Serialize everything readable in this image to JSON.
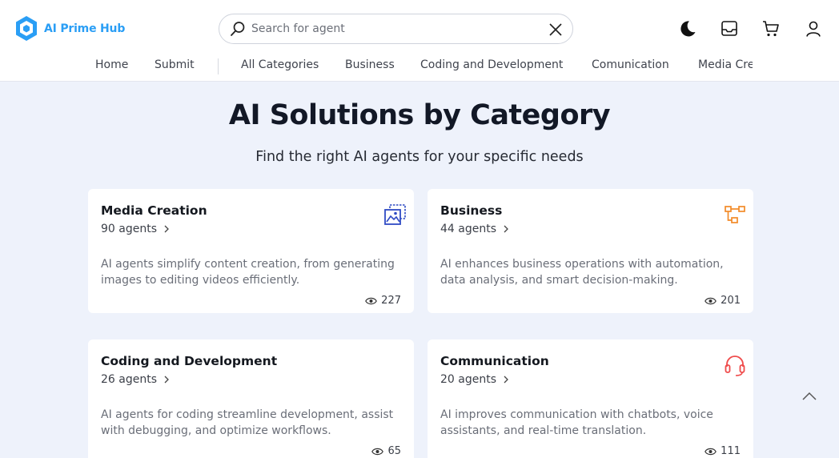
{
  "brand": {
    "name": "AI Prime Hub",
    "color": "#2a9ef5"
  },
  "search": {
    "placeholder": "Search for agent",
    "value": ""
  },
  "header_icons": [
    "moon-icon",
    "inbox-icon",
    "cart-icon",
    "user-icon"
  ],
  "nav": {
    "items": [
      {
        "label": "Home"
      },
      {
        "label": "Submit"
      },
      {
        "label": "All Categories"
      },
      {
        "label": "Business"
      },
      {
        "label": "Coding and Development"
      },
      {
        "label": "Comunication"
      },
      {
        "label": "Media Cre"
      }
    ]
  },
  "hero": {
    "title": "AI Solutions by Category",
    "subtitle": "Find the right AI agents for your specific needs"
  },
  "cards": [
    {
      "title": "Media Creation",
      "count": "90 agents",
      "description": "AI agents simplify content creation, from generating images to editing videos efficiently.",
      "views": "227",
      "icon": "media-gallery-icon",
      "icon_color": "#2f4bc4"
    },
    {
      "title": "Business",
      "count": "44 agents",
      "description": "AI enhances business operations with automation, data analysis, and smart decision-making.",
      "views": "201",
      "icon": "workflow-icon",
      "icon_color": "#f28a28"
    },
    {
      "title": "Coding and Development",
      "count": "26 agents",
      "description": "AI agents for coding streamline development, assist with debugging, and optimize workflows.",
      "views": "65",
      "icon": "",
      "icon_color": ""
    },
    {
      "title": "Communication",
      "count": "20 agents",
      "description": "AI improves communication with chatbots, voice assistants, and real-time translation.",
      "views": "111",
      "icon": "headset-icon",
      "icon_color": "#ef4b4b"
    }
  ]
}
